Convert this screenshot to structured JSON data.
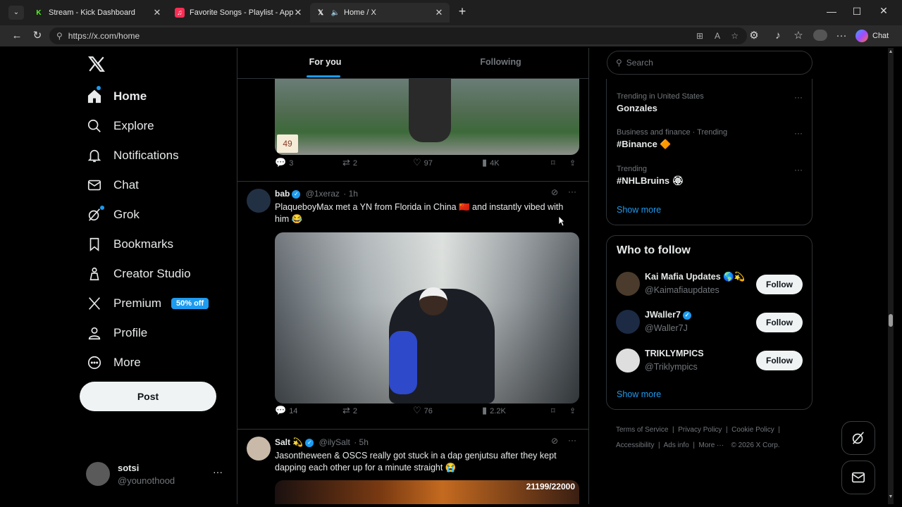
{
  "tabs": [
    {
      "title": "Stream - Kick Dashboard",
      "icon": "kick-icon"
    },
    {
      "title": "Favorite Songs - Playlist - Apple M",
      "icon": "apple-music-icon"
    },
    {
      "title": "Home / X",
      "icon": "x-icon"
    }
  ],
  "address": {
    "url": "https://x.com/home"
  },
  "browser": {
    "chat_label": "Chat"
  },
  "sidebar": {
    "items": [
      {
        "label": "Home"
      },
      {
        "label": "Explore"
      },
      {
        "label": "Notifications"
      },
      {
        "label": "Chat"
      },
      {
        "label": "Grok"
      },
      {
        "label": "Bookmarks"
      },
      {
        "label": "Creator Studio"
      },
      {
        "label": "Premium",
        "badge": "50% off"
      },
      {
        "label": "Profile"
      },
      {
        "label": "More"
      }
    ],
    "post_button": "Post",
    "account": {
      "name": "sotsi",
      "handle": "@younothood"
    }
  },
  "feed": {
    "tabs": [
      "For you",
      "Following"
    ],
    "first_tweet": {
      "video_badge": "49",
      "replies": "3",
      "reposts": "2",
      "likes": "97",
      "views": "4K"
    },
    "second_tweet": {
      "name": "bab",
      "handle": "@1xeraz",
      "time": "· 1h",
      "text": "PlaqueboyMax met a YN from Florida in China 🇨🇳 and instantly vibed with him 😂",
      "replies": "14",
      "reposts": "2",
      "likes": "76",
      "views": "2.2K"
    },
    "third_tweet": {
      "name": "Salt 💫",
      "handle": "@ilySalt",
      "time": "· 5h",
      "text": "Jasontheween & OSCS really got stuck in a dap genjutsu after they kept dapping each other up for a minute straight 😭",
      "overlay": "21199/22000"
    }
  },
  "right": {
    "search_placeholder": "Search",
    "trends": [
      {
        "context": "Trending in United States",
        "title": "Gonzales"
      },
      {
        "context": "Business and finance · Trending",
        "title": "#Binance 🔶"
      },
      {
        "context": "Trending",
        "title": "#NHLBruins 🏵"
      }
    ],
    "trends_show_more": "Show more",
    "who_to_follow_title": "Who to follow",
    "who_to_follow": [
      {
        "name": "Kai Mafia Updates 🌎💫",
        "handle": "@Kaimafiaupdates",
        "button": "Follow"
      },
      {
        "name": "JWaller7",
        "handle": "@Waller7J",
        "button": "Follow"
      },
      {
        "name": "TRIKLYMPICS",
        "handle": "@Triklympics",
        "button": "Follow"
      }
    ],
    "follow_show_more": "Show more",
    "footer": [
      "Terms of Service",
      "Privacy Policy",
      "Cookie Policy",
      "Accessibility",
      "Ads info",
      "More ···",
      "© 2026 X Corp."
    ]
  }
}
